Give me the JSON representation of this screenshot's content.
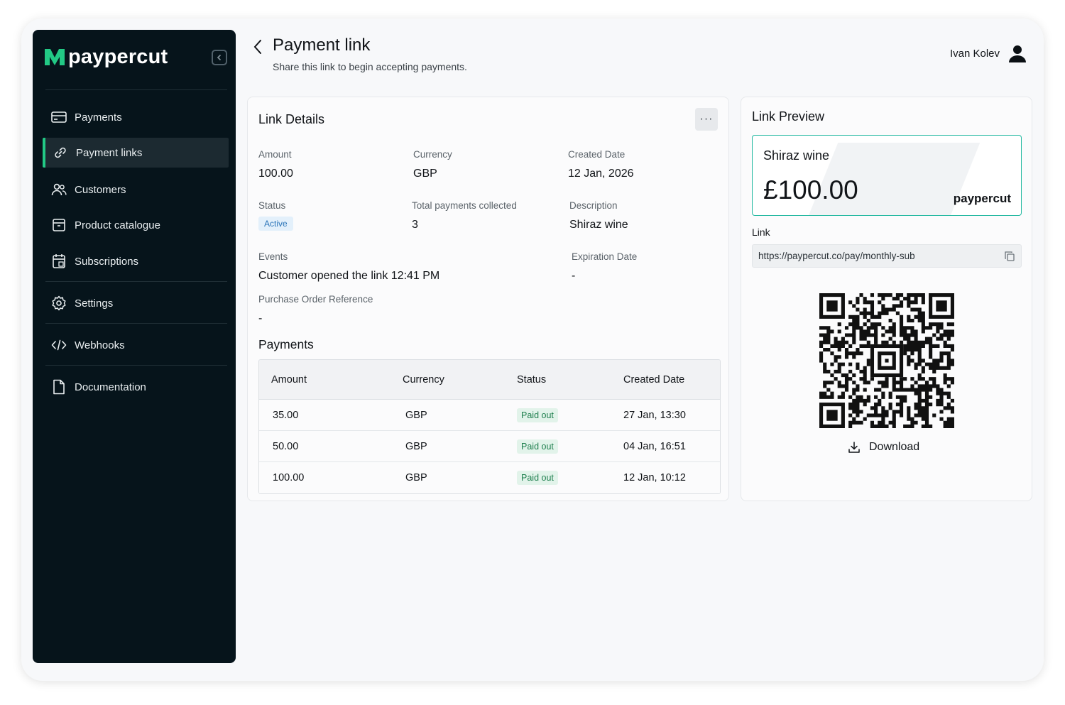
{
  "brand": {
    "name": "paypercut",
    "accent": "#22c985"
  },
  "sidebar": {
    "items": [
      {
        "label": "Payments",
        "icon": "credit-card-icon"
      },
      {
        "label": "Payment links",
        "icon": "link-icon",
        "active": true
      },
      {
        "label": "Customers",
        "icon": "users-icon"
      },
      {
        "label": "Product catalogue",
        "icon": "archive-box-icon"
      },
      {
        "label": "Subscriptions",
        "icon": "calendar-icon"
      },
      {
        "label": "Settings",
        "icon": "gear-icon"
      },
      {
        "label": "Webhooks",
        "icon": "code-icon"
      },
      {
        "label": "Documentation",
        "icon": "document-icon"
      }
    ]
  },
  "header": {
    "title": "Payment link",
    "subtitle": "Share this link to begin accepting payments.",
    "user_name": "Ivan Kolev"
  },
  "details": {
    "title": "Link Details",
    "more_label": "···",
    "amount_label": "Amount",
    "amount": "100.00",
    "currency_label": "Currency",
    "currency": "GBP",
    "created_label": "Created Date",
    "created": "12 Jan, 2026",
    "status_label": "Status",
    "status": "Active",
    "total_label": "Total payments collected",
    "total": "3",
    "description_label": "Description",
    "description": "Shiraz wine",
    "events_label": "Events",
    "events": "Customer opened the link 12:41 PM",
    "expiration_label": "Expiration Date",
    "expiration": "-",
    "po_label": "Purchase Order Reference",
    "po": "-"
  },
  "payments": {
    "title": "Payments",
    "headers": [
      "Amount",
      "Currency",
      "Status",
      "Created Date"
    ],
    "rows": [
      [
        "35.00",
        "GBP",
        "Paid out",
        "27 Jan, 13:30"
      ],
      [
        "50.00",
        "GBP",
        "Paid out",
        "04 Jan, 16:51"
      ],
      [
        "100.00",
        "GBP",
        "Paid out",
        "12 Jan, 10:12"
      ]
    ]
  },
  "preview": {
    "title": "Link Preview",
    "product": "Shiraz wine",
    "amount": "£100.00",
    "brand": "paypercut",
    "link_label": "Link",
    "link": "https://paypercut.co/pay/monthly-sub",
    "download_label": "Download"
  }
}
